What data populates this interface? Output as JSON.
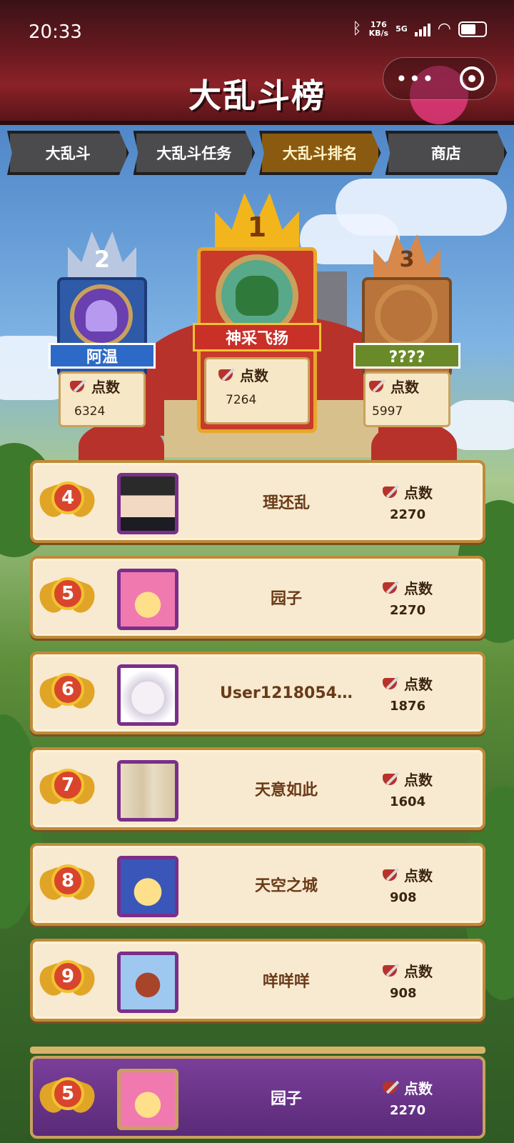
{
  "status_bar": {
    "time": "20:33",
    "net_speed_value": "176",
    "net_speed_unit": "KB/s",
    "network": "5G"
  },
  "header": {
    "title": "大乱斗榜"
  },
  "tabs": [
    {
      "label": "大乱斗",
      "active": false
    },
    {
      "label": "大乱斗任务",
      "active": false
    },
    {
      "label": "大乱斗排名",
      "active": true
    },
    {
      "label": "商店",
      "active": false
    }
  ],
  "points_label": "点数",
  "podium": {
    "first": {
      "rank": "1",
      "name": "神采飞扬",
      "points": "7264"
    },
    "second": {
      "rank": "2",
      "name": "阿温",
      "points": "6324"
    },
    "third": {
      "rank": "3",
      "name": "????",
      "points": "5997"
    }
  },
  "ranking": [
    {
      "rank": "4",
      "name": "理还乱",
      "points": "2270"
    },
    {
      "rank": "5",
      "name": "园子",
      "points": "2270"
    },
    {
      "rank": "6",
      "name": "User1218054…",
      "points": "1876"
    },
    {
      "rank": "7",
      "name": "天意如此",
      "points": "1604"
    },
    {
      "rank": "8",
      "name": "天空之城",
      "points": "908"
    },
    {
      "rank": "9",
      "name": "咩咩咩",
      "points": "908"
    }
  ],
  "my_rank": {
    "rank": "5",
    "name": "园子",
    "points": "2270"
  },
  "colors": {
    "header": "#6b1a20",
    "tab_active": "#8a5a10",
    "tab_inactive": "#4b4b4e",
    "row_bg": "#f7ead0",
    "my_row_bg": "#5a2a78",
    "medal": "#d9452c"
  }
}
